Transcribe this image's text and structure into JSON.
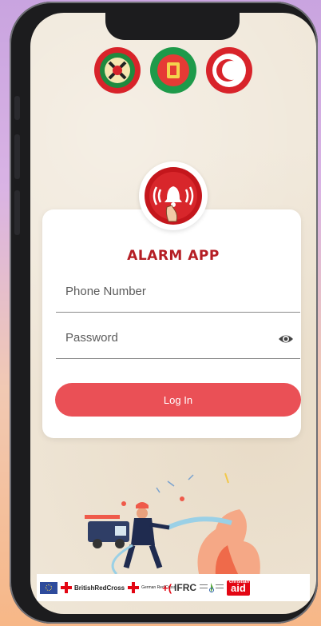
{
  "app": {
    "title": "ALARM APP"
  },
  "form": {
    "phone_label": "Phone Number",
    "password_label": "Password",
    "login_label": "Log In"
  },
  "colors": {
    "accent": "#ea5056",
    "title_red": "#b51e24",
    "card_bg": "#ffffff",
    "screen_bg": "#efe6d7"
  },
  "logos": [
    {
      "name": "fire-service-logo",
      "color": "#d8232a"
    },
    {
      "name": "government-seal-logo",
      "color": "#1e9a4a"
    },
    {
      "name": "bdrcs-logo",
      "color": "#d8232a"
    }
  ],
  "sponsors": {
    "british_red_cross": "BritishRedCross",
    "german_red_cross": "German Red Cross",
    "ifrc": "IFRC",
    "christian_aid": "aid",
    "christian_aid_small": "christian"
  },
  "icons": {
    "password_toggle": "eye-icon",
    "alarm": "alarm-bell-icon"
  }
}
